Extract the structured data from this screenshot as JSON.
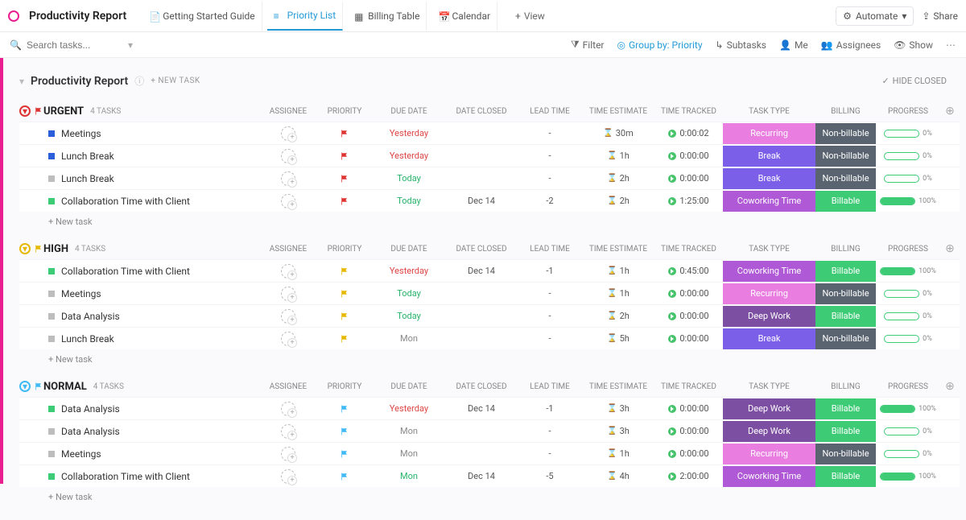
{
  "header": {
    "title": "Productivity Report",
    "tabs": [
      {
        "label": "Getting Started Guide",
        "active": false
      },
      {
        "label": "Priority List",
        "active": true
      },
      {
        "label": "Billing Table",
        "active": false
      },
      {
        "label": "Calendar",
        "active": false
      }
    ],
    "view_button": "View",
    "automate": "Automate",
    "share": "Share"
  },
  "filters": {
    "search_placeholder": "Search tasks...",
    "filter": "Filter",
    "groupby": "Group by: Priority",
    "subtasks": "Subtasks",
    "me": "Me",
    "assignees": "Assignees",
    "show": "Show"
  },
  "list": {
    "title": "Productivity Report",
    "new_task": "+ NEW TASK",
    "hide_closed": "HIDE CLOSED"
  },
  "columns": {
    "assignee": "ASSIGNEE",
    "priority": "PRIORITY",
    "due": "DUE DATE",
    "closed": "DATE CLOSED",
    "lead": "LEAD TIME",
    "est": "TIME ESTIMATE",
    "track": "TIME TRACKED",
    "type": "TASK TYPE",
    "bill": "BILLING",
    "prog": "PROGRESS"
  },
  "groups": [
    {
      "name": "URGENT",
      "count": "4 TASKS",
      "flag_color": "#d33",
      "circle": "red",
      "rows": [
        {
          "status": "#2b5fd9",
          "name": "Meetings",
          "flag": "#d33",
          "due": "Yesterday",
          "due_cls": "red",
          "closed": "",
          "lead": "-",
          "est": "30m",
          "track": "0:00:02",
          "type": "Recurring",
          "type_cls": "recurring",
          "bill": "Non-billable",
          "bill_cls": "nonbill",
          "prog": 0
        },
        {
          "status": "#2b5fd9",
          "name": "Lunch Break",
          "flag": "#d33",
          "due": "Yesterday",
          "due_cls": "red",
          "closed": "",
          "lead": "-",
          "est": "1h",
          "track": "0:00:00",
          "type": "Break",
          "type_cls": "break",
          "bill": "Non-billable",
          "bill_cls": "nonbill",
          "prog": 0
        },
        {
          "status": "#bdbdbd",
          "name": "Lunch Break",
          "flag": "#d33",
          "due": "Today",
          "due_cls": "green",
          "closed": "",
          "lead": "-",
          "est": "2h",
          "track": "0:00:00",
          "type": "Break",
          "type_cls": "break",
          "bill": "Non-billable",
          "bill_cls": "nonbill",
          "prog": 0
        },
        {
          "status": "#3ecb76",
          "name": "Collaboration Time with Client",
          "flag": "#d33",
          "due": "Today",
          "due_cls": "green",
          "closed": "Dec 14",
          "lead": "-2",
          "est": "2h",
          "track": "1:25:00",
          "type": "Coworking Time",
          "type_cls": "coworking",
          "bill": "Billable",
          "bill_cls": "bill",
          "prog": 100
        }
      ]
    },
    {
      "name": "HIGH",
      "count": "4 TASKS",
      "flag_color": "#e6b800",
      "circle": "yellow",
      "rows": [
        {
          "status": "#3ecb76",
          "name": "Collaboration Time with Client",
          "flag": "#e6b800",
          "due": "Yesterday",
          "due_cls": "red",
          "closed": "Dec 14",
          "lead": "-1",
          "est": "1h",
          "track": "0:45:00",
          "type": "Coworking Time",
          "type_cls": "coworking",
          "bill": "Billable",
          "bill_cls": "bill",
          "prog": 100
        },
        {
          "status": "#bdbdbd",
          "name": "Meetings",
          "flag": "#e6b800",
          "due": "Today",
          "due_cls": "green",
          "closed": "",
          "lead": "-",
          "est": "1h",
          "track": "0:00:00",
          "type": "Recurring",
          "type_cls": "recurring",
          "bill": "Non-billable",
          "bill_cls": "nonbill",
          "prog": 0
        },
        {
          "status": "#bdbdbd",
          "name": "Data Analysis",
          "flag": "#e6b800",
          "due": "Today",
          "due_cls": "green",
          "closed": "",
          "lead": "-",
          "est": "2h",
          "track": "0:00:00",
          "type": "Deep Work",
          "type_cls": "deepwork",
          "bill": "Billable",
          "bill_cls": "bill",
          "prog": 0
        },
        {
          "status": "#bdbdbd",
          "name": "Lunch Break",
          "flag": "#e6b800",
          "due": "Mon",
          "due_cls": "gray",
          "closed": "",
          "lead": "-",
          "est": "5h",
          "track": "0:00:00",
          "type": "Break",
          "type_cls": "break",
          "bill": "Non-billable",
          "bill_cls": "nonbill",
          "prog": 0
        }
      ]
    },
    {
      "name": "NORMAL",
      "count": "4 TASKS",
      "flag_color": "#3fbaf5",
      "circle": "blue",
      "rows": [
        {
          "status": "#3ecb76",
          "name": "Data Analysis",
          "flag": "#3fbaf5",
          "due": "Yesterday",
          "due_cls": "red",
          "closed": "Dec 14",
          "lead": "-1",
          "est": "3h",
          "track": "0:00:00",
          "type": "Deep Work",
          "type_cls": "deepwork",
          "bill": "Billable",
          "bill_cls": "bill",
          "prog": 100
        },
        {
          "status": "#bdbdbd",
          "name": "Data Analysis",
          "flag": "#3fbaf5",
          "due": "Mon",
          "due_cls": "gray",
          "closed": "",
          "lead": "-",
          "est": "3h",
          "track": "0:00:00",
          "type": "Deep Work",
          "type_cls": "deepwork",
          "bill": "Billable",
          "bill_cls": "bill",
          "prog": 0
        },
        {
          "status": "#bdbdbd",
          "name": "Meetings",
          "flag": "#3fbaf5",
          "due": "Mon",
          "due_cls": "gray",
          "closed": "",
          "lead": "-",
          "est": "1h",
          "track": "0:00:00",
          "type": "Recurring",
          "type_cls": "recurring",
          "bill": "Non-billable",
          "bill_cls": "nonbill",
          "prog": 0
        },
        {
          "status": "#3ecb76",
          "name": "Collaboration Time with Client",
          "flag": "#3fbaf5",
          "due": "Mon",
          "due_cls": "green",
          "closed": "Dec 14",
          "lead": "-5",
          "est": "4h",
          "track": "2:00:00",
          "type": "Coworking Time",
          "type_cls": "coworking",
          "bill": "Billable",
          "bill_cls": "bill",
          "prog": 100
        }
      ]
    }
  ],
  "labels": {
    "new_task_row": "+ New task"
  }
}
